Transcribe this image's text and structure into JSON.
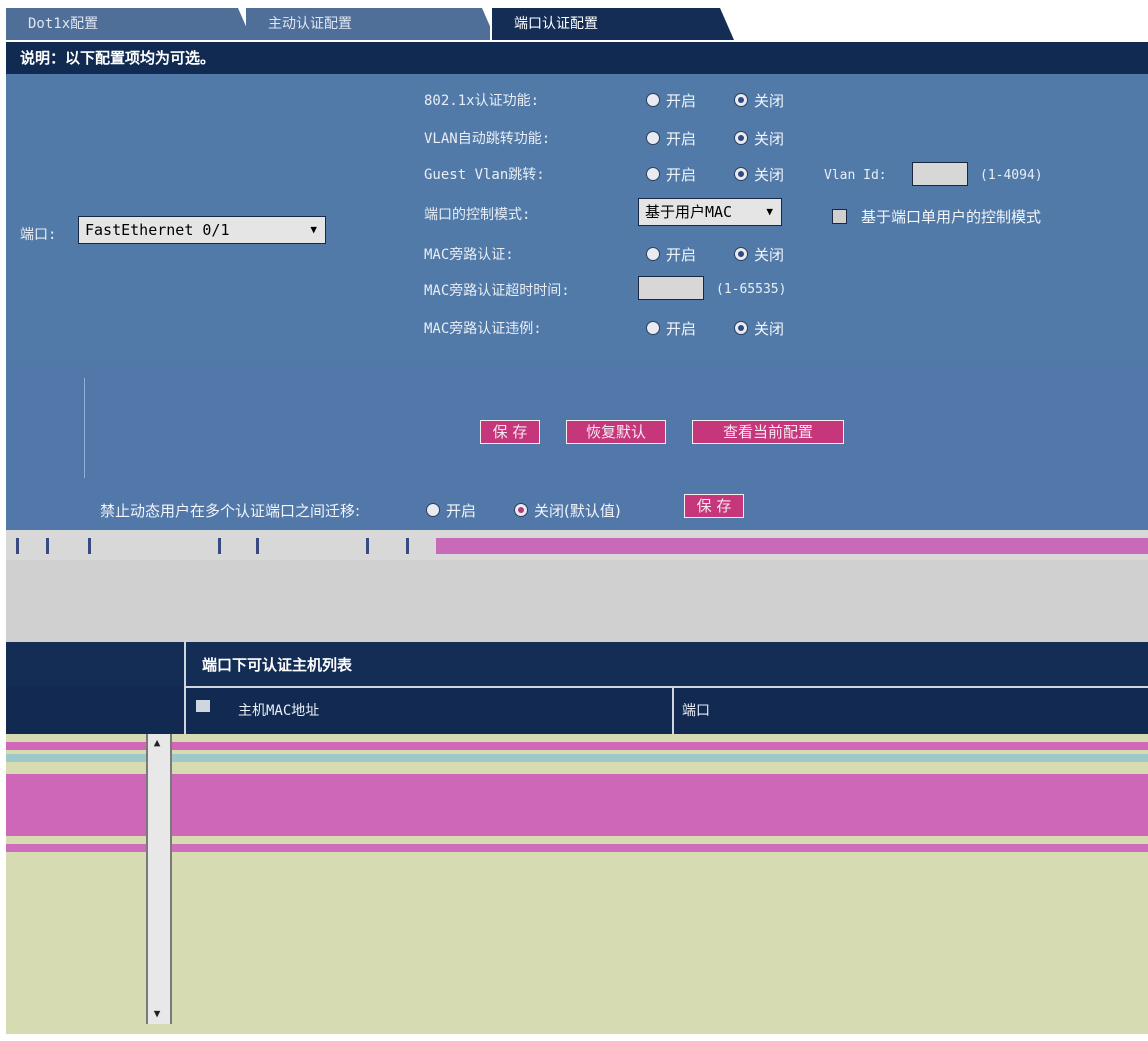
{
  "tabs": [
    "Dot1x配置",
    "主动认证配置",
    "端口认证配置"
  ],
  "note": "说明：以下配置项均为可选。",
  "port": {
    "label": "端口:",
    "value": "FastEthernet 0/1"
  },
  "rows": {
    "dot1x": {
      "label": "802.1x认证功能:",
      "on": "开启",
      "off": "关闭"
    },
    "vlan_jump": {
      "label": "VLAN自动跳转功能:",
      "on": "开启",
      "off": "关闭"
    },
    "guest_vlan": {
      "label": "Guest Vlan跳转:",
      "on": "开启",
      "off": "关闭",
      "vlan_id_label": "Vlan Id:",
      "range": "(1-4094)"
    },
    "control_mode": {
      "label": "端口的控制模式:",
      "value": "基于用户MAC",
      "checkbox_label": "基于端口单用户的控制模式"
    },
    "mac_bypass": {
      "label": "MAC旁路认证:",
      "on": "开启",
      "off": "关闭"
    },
    "mac_bypass_timeout": {
      "label": "MAC旁路认证超时时间:",
      "range": "(1-65535)"
    },
    "mac_bypass_violation": {
      "label": "MAC旁路认证违例:",
      "on": "开启",
      "off": "关闭"
    }
  },
  "buttons": {
    "save": "保 存",
    "restore": "恢复默认",
    "view": "查看当前配置"
  },
  "migrate": {
    "label": "禁止动态用户在多个认证端口之间迁移:",
    "on": "开启",
    "off": "关闭(默认值)",
    "save": "保 存"
  },
  "list": {
    "title": "端口下可认证主机列表",
    "col_mac": "主机MAC地址",
    "col_port": "端口"
  }
}
